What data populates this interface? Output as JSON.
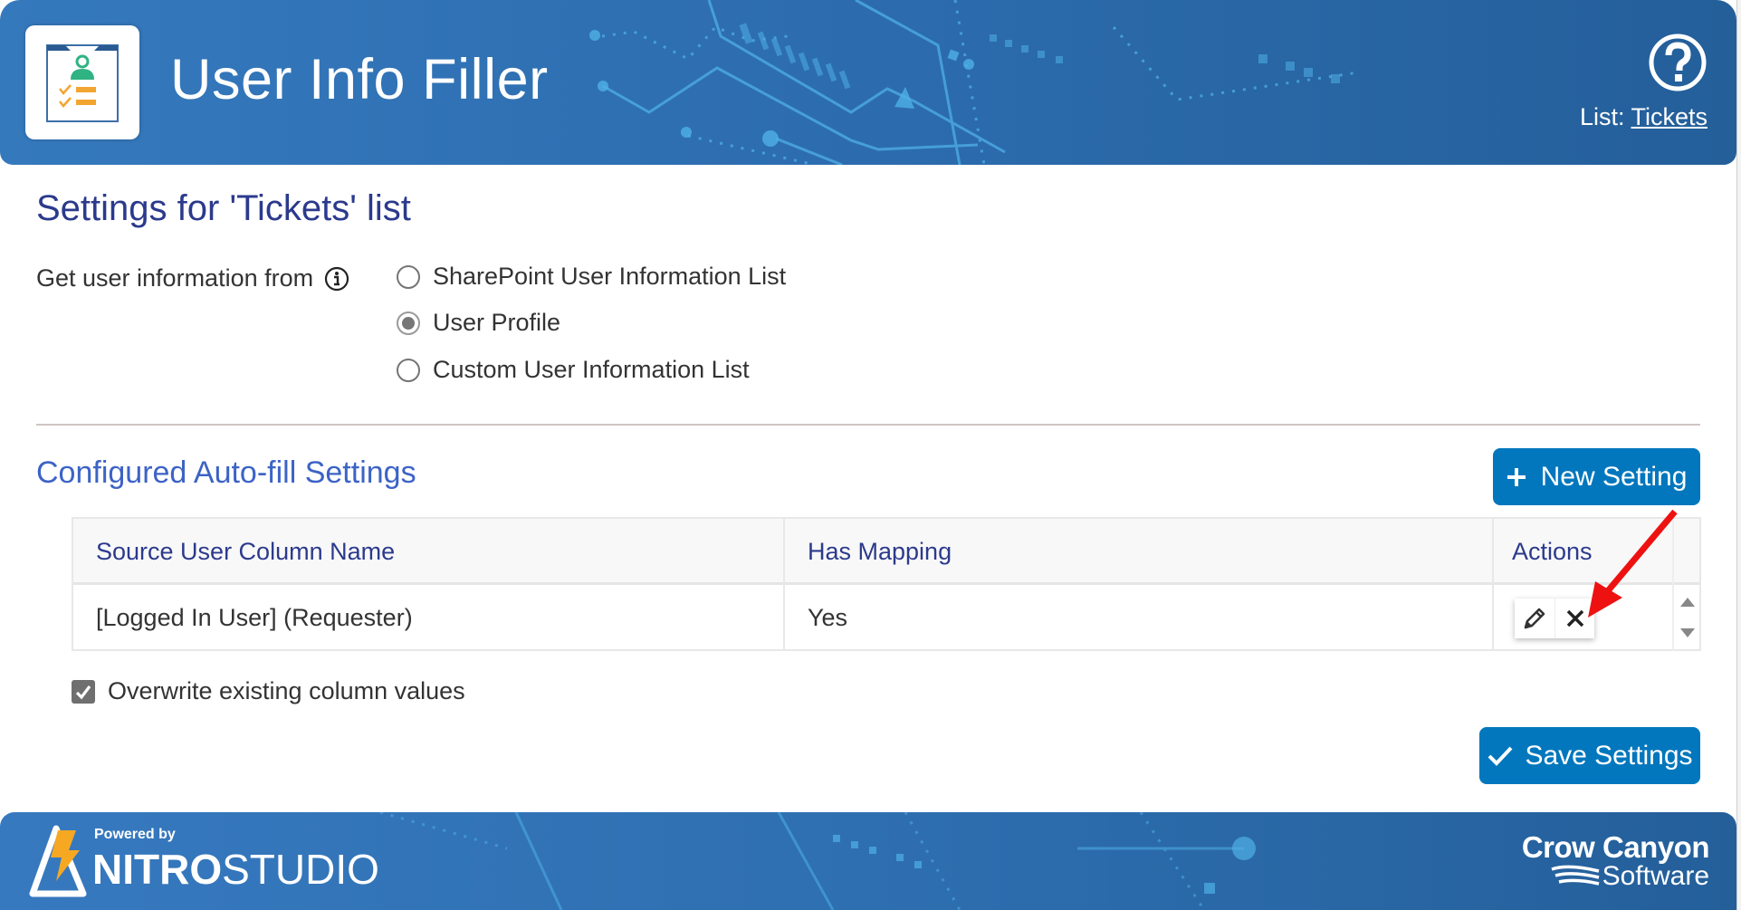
{
  "header": {
    "app_title": "User Info Filler",
    "list_prefix": "List:",
    "list_name": "Tickets",
    "help_icon": "question-circle-icon",
    "logo_icon": "clipboard-user-checklist-icon"
  },
  "settings": {
    "title": "Settings for 'Tickets' list",
    "source_label": "Get user information from",
    "info_icon": "info-circle-icon",
    "source_options": [
      {
        "label": "SharePoint User Information List",
        "selected": false
      },
      {
        "label": "User Profile",
        "selected": true
      },
      {
        "label": "Custom User Information List",
        "selected": false
      }
    ]
  },
  "autofill": {
    "title": "Configured Auto-fill Settings",
    "new_button": "New Setting",
    "columns": [
      "Source User Column Name",
      "Has Mapping",
      "Actions"
    ],
    "rows": [
      {
        "source": "[Logged In User] (Requester)",
        "has_mapping": "Yes"
      }
    ],
    "actions": {
      "edit_icon": "pencil-icon",
      "delete_icon": "close-icon"
    },
    "overwrite_label": "Overwrite existing column values",
    "overwrite_checked": true,
    "save_button": "Save Settings"
  },
  "footer": {
    "powered_by": "Powered by",
    "nitro_bold": "NITRO",
    "nitro_light": "STUDIO",
    "company_line1": "Crow Canyon",
    "company_line2": "Software"
  },
  "colors": {
    "header_blue": "#2c6cae",
    "button_blue": "#0277bd",
    "title_navy": "#2b3a8c",
    "section_blue": "#3c63c6",
    "annotation_red": "#ee1111"
  }
}
